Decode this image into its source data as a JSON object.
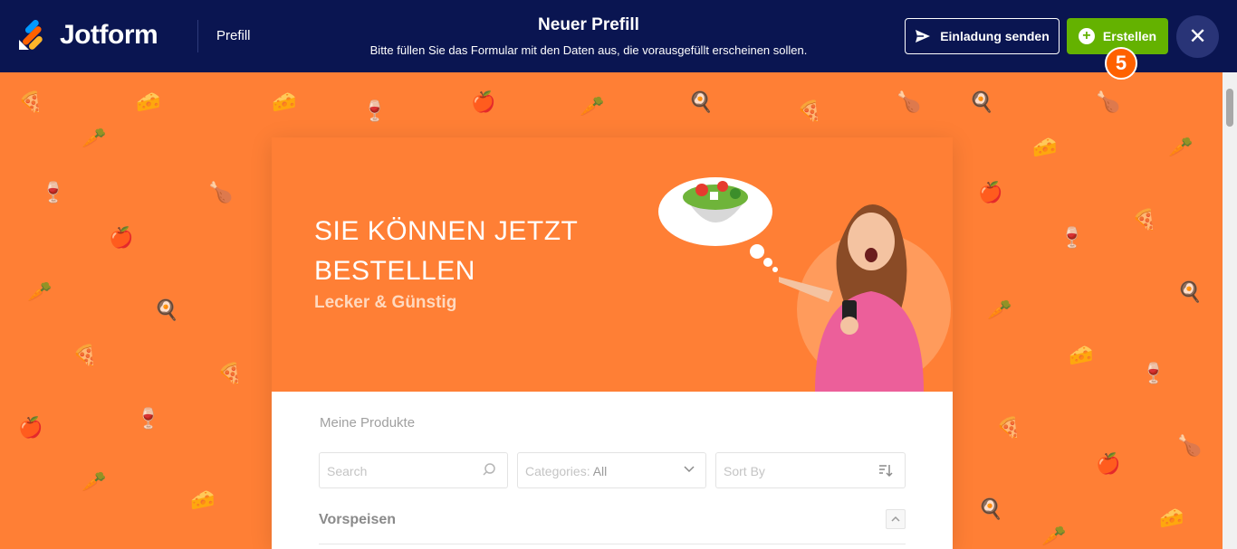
{
  "header": {
    "brand": "Jotform",
    "breadcrumb": "Prefill",
    "title": "Neuer Prefill",
    "subtitle": "Bitte füllen Sie das Formular mit den Daten aus, die vorausgefüllt erscheinen sollen.",
    "invite_label": "Einladung senden",
    "create_label": "Erstellen",
    "step_badge": "5"
  },
  "form": {
    "hero_title": "SIE KÖNNEN JETZT BESTELLEN",
    "hero_subtitle": "Lecker & Günstig",
    "section_title": "Meine Produkte",
    "search_placeholder": "Search",
    "categories_label": "Categories:",
    "categories_value": "All",
    "sort_label": "Sort By",
    "category_heading": "Vorspeisen"
  },
  "colors": {
    "topbar": "#0a1551",
    "accent_orange": "#ff7f35",
    "create_green": "#64b200",
    "badge_orange": "#ff6100"
  }
}
